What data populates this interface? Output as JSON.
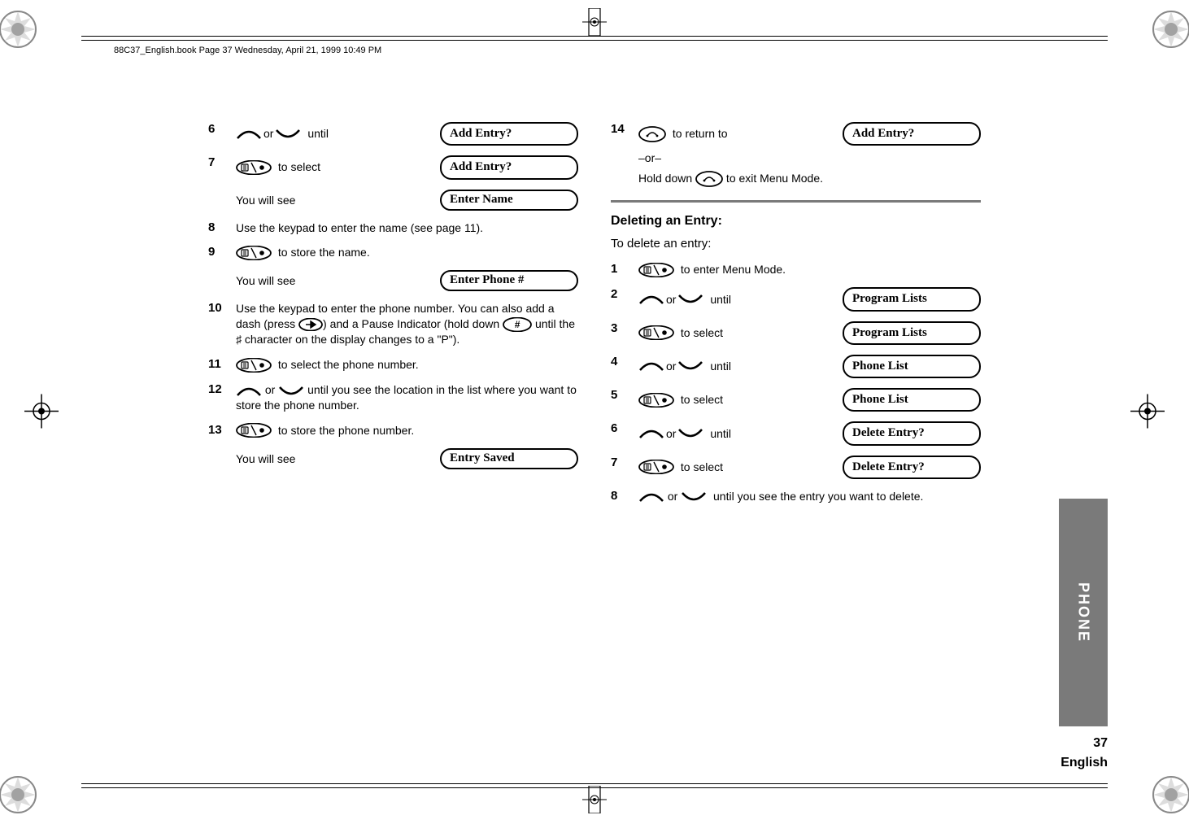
{
  "page_header": "88C37_English.book  Page 37  Wednesday, April 21, 1999  10:49 PM",
  "left": {
    "step6": {
      "num": "6",
      "label_or": "or",
      "label_until": "until",
      "pill": "Add Entry?"
    },
    "step7": {
      "num": "7",
      "label": "to select",
      "pill": "Add Entry?",
      "sub_label": "You will see",
      "sub_pill": "Enter Name"
    },
    "step8": {
      "num": "8",
      "text": "Use the keypad to enter the name (see page 11)."
    },
    "step9": {
      "num": "9",
      "label": "to store the name.",
      "sub_label": "You will see",
      "sub_pill": "Enter Phone #"
    },
    "step10": {
      "num": "10",
      "text_a": "Use the keypad to enter the phone number. You can also add a dash (press ",
      "text_b": ") and a Pause Indicator (hold down ",
      "text_c": " until the ",
      "pause_char": "♯",
      "text_d": " character on the display changes to a \"P\")."
    },
    "step11": {
      "num": "11",
      "label": "to select the phone number."
    },
    "step12": {
      "num": "12",
      "label_or": "or",
      "label_after": "until you see the location in the list where you want to store the phone number."
    },
    "step13": {
      "num": "13",
      "label": "to store the phone number.",
      "sub_label": "You will see",
      "sub_pill": "Entry Saved"
    }
  },
  "right": {
    "step14": {
      "num": "14",
      "label": "to return to",
      "pill": "Add Entry?",
      "or": "–or–",
      "hold_a": "Hold down ",
      "hold_b": " to exit Menu Mode."
    },
    "heading": "Deleting an Entry:",
    "intro": "To delete an entry:",
    "d1": {
      "num": "1",
      "label": "to enter Menu Mode."
    },
    "d2": {
      "num": "2",
      "label_or": "or",
      "label_until": "until",
      "pill": "Program Lists"
    },
    "d3": {
      "num": "3",
      "label": "to select",
      "pill": "Program Lists"
    },
    "d4": {
      "num": "4",
      "label_or": "or",
      "label_until": "until",
      "pill": "Phone List"
    },
    "d5": {
      "num": "5",
      "label": "to select",
      "pill": "Phone List"
    },
    "d6": {
      "num": "6",
      "label_or": "or",
      "label_until": "until",
      "pill": "Delete Entry?"
    },
    "d7": {
      "num": "7",
      "label": "to select",
      "pill": "Delete Entry?"
    },
    "d8": {
      "num": "8",
      "label_or": "or",
      "label_after": "until you see the entry you want to delete."
    }
  },
  "side_tab": "PHONE",
  "footer": {
    "pagenum": "37",
    "lang": "English"
  }
}
